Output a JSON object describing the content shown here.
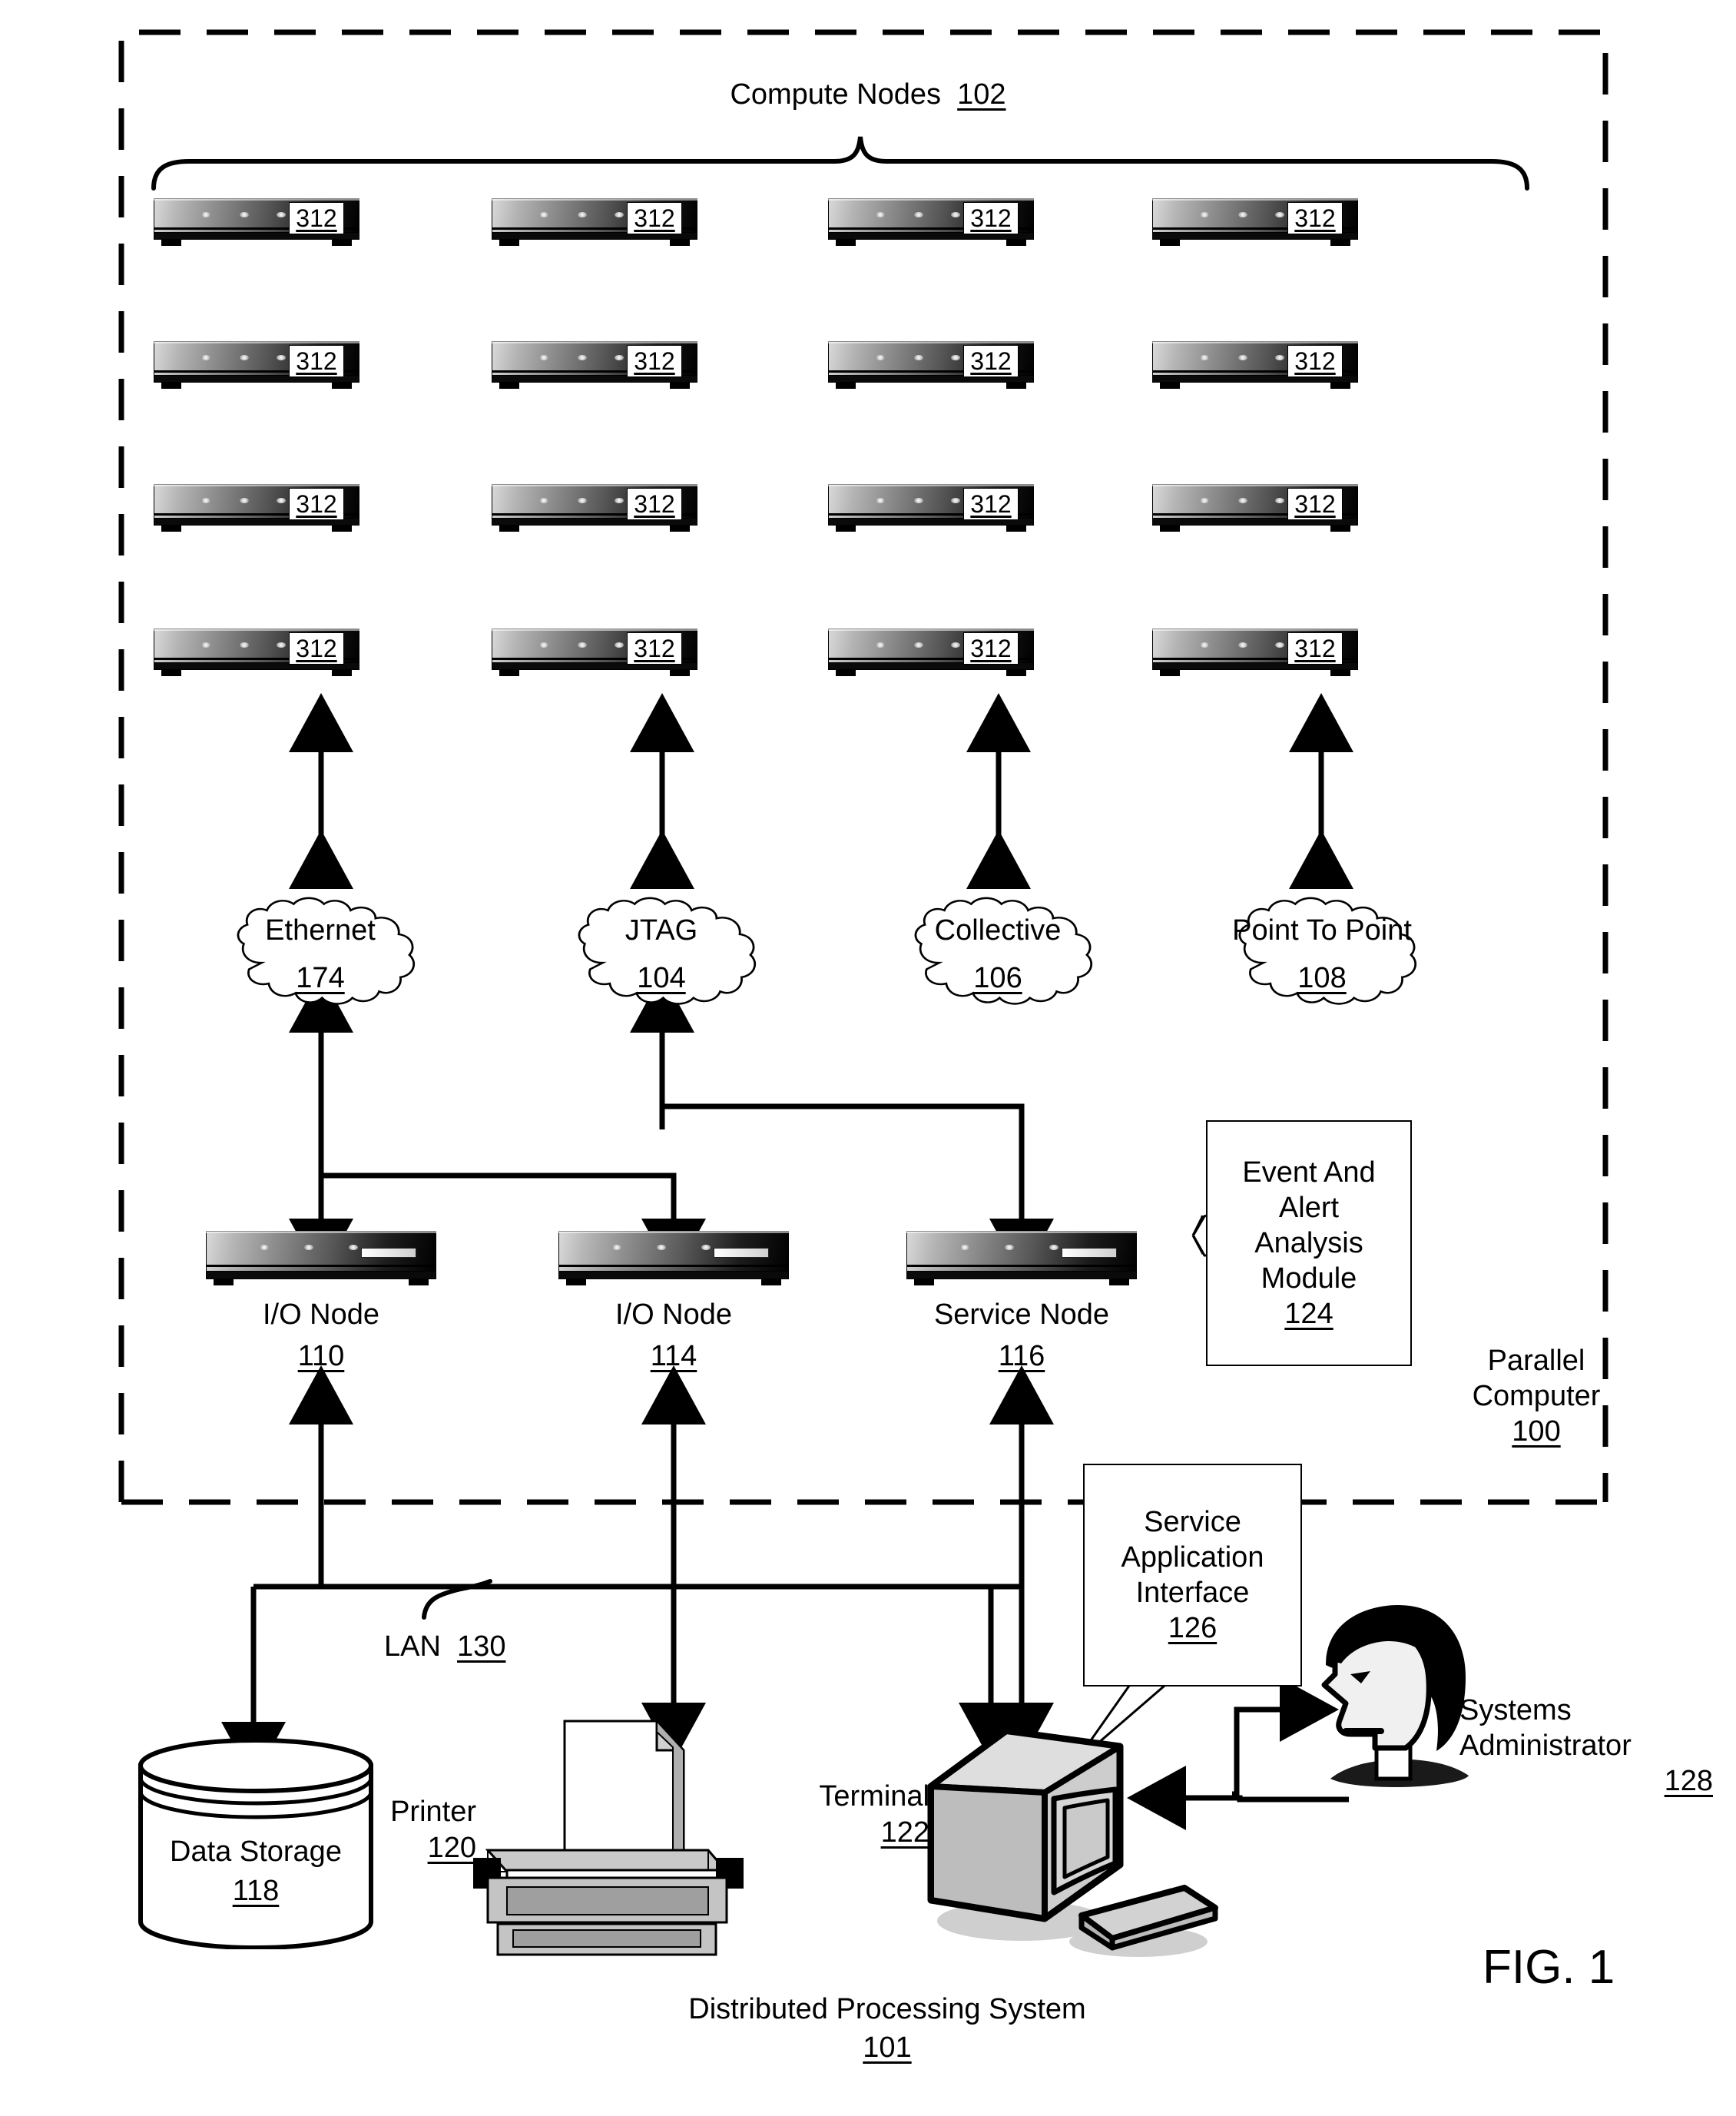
{
  "figure": {
    "label": "FIG. 1",
    "caption": "Distributed Processing System",
    "caption_number": "101"
  },
  "parallel_computer": {
    "label_line1": "Parallel",
    "label_line2": "Computer",
    "number": "100"
  },
  "compute_nodes": {
    "title": "Compute Nodes",
    "number": "102",
    "node_label": "312",
    "rows": 4,
    "cols": 4,
    "nodes": [
      "312",
      "312",
      "312",
      "312",
      "312",
      "312",
      "312",
      "312",
      "312",
      "312",
      "312",
      "312",
      "312",
      "312",
      "312",
      "312"
    ]
  },
  "networks": [
    {
      "name": "Ethernet",
      "number": "174"
    },
    {
      "name": "JTAG",
      "number": "104"
    },
    {
      "name": "Collective",
      "number": "106"
    },
    {
      "name": "Point To Point",
      "number": "108"
    }
  ],
  "service_tier": [
    {
      "name": "I/O Node",
      "number": "110"
    },
    {
      "name": "I/O Node",
      "number": "114"
    },
    {
      "name": "Service Node",
      "number": "116"
    }
  ],
  "event_alert_module": {
    "line1": "Event And",
    "line2": "Alert",
    "line3": "Analysis",
    "line4": "Module",
    "number": "124"
  },
  "service_application_interface": {
    "line1": "Service",
    "line2": "Application",
    "line3": "Interface",
    "number": "126"
  },
  "lan": {
    "name": "LAN",
    "number": "130"
  },
  "peripherals": {
    "data_storage": {
      "name": "Data Storage",
      "number": "118"
    },
    "printer": {
      "name": "Printer",
      "number": "120"
    },
    "terminal": {
      "name": "Terminal",
      "number": "122"
    },
    "administrator": {
      "line1": "Systems",
      "line2": "Administrator",
      "number": "128"
    }
  },
  "colors": {
    "ink": "#000000",
    "paper": "#ffffff"
  }
}
